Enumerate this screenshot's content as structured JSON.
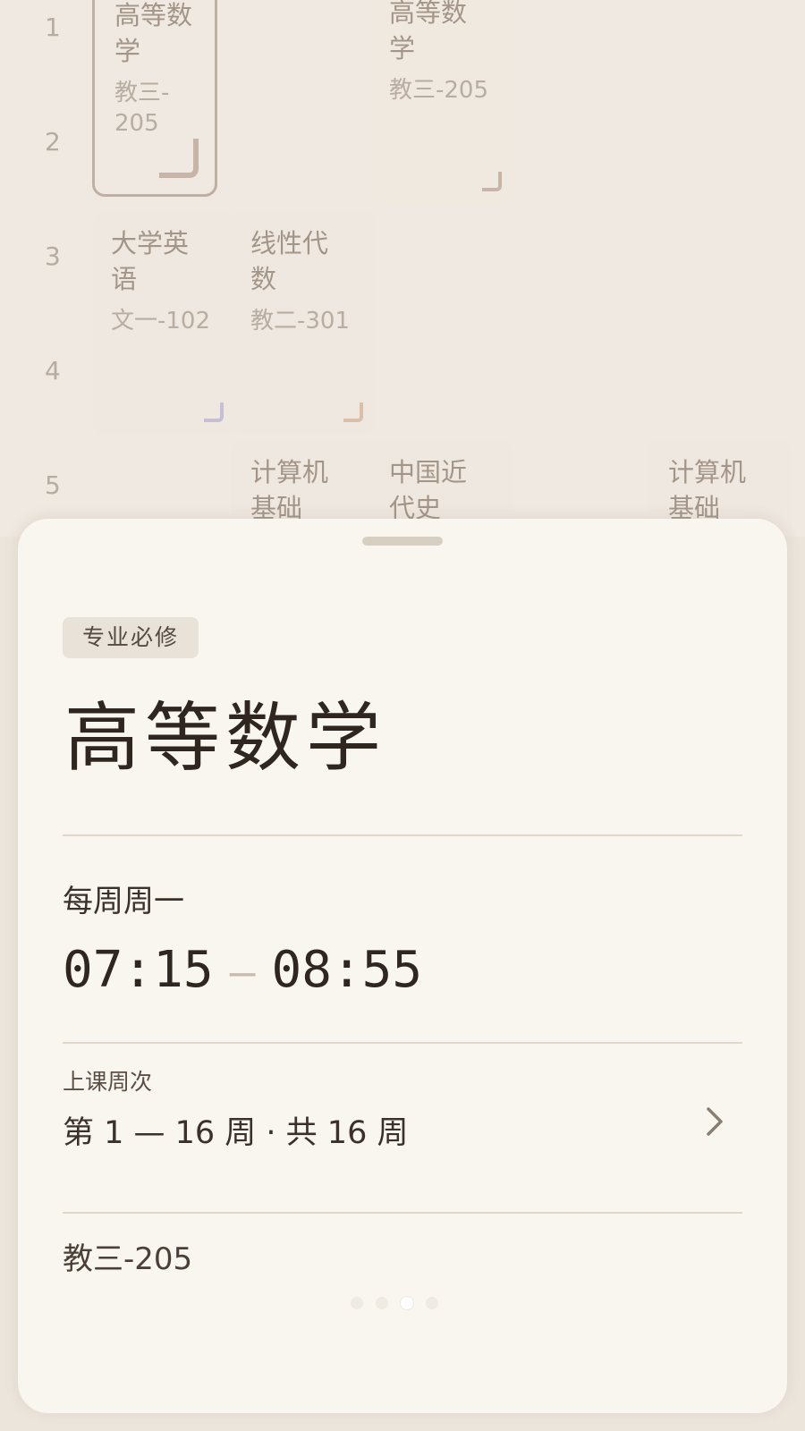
{
  "timetable": {
    "row_numbers": [
      "1",
      "2",
      "3",
      "4",
      "5"
    ],
    "cells": [
      {
        "name": "高等数学",
        "room": "教三-205"
      },
      {
        "name": "高等数学",
        "room": "教三-205"
      },
      {
        "name": "大学英语",
        "room": "文一-102"
      },
      {
        "name": "线性代数",
        "room": "教二-301"
      },
      {
        "name": "计算机基础",
        "room": ""
      },
      {
        "name": "中国近代史",
        "room": ""
      },
      {
        "name": "计算机基础",
        "room": ""
      }
    ]
  },
  "sheet": {
    "tag": "专业必修",
    "title": "高等数学",
    "repeat": "每周周一",
    "time_start": "07:15",
    "time_end": "08:55",
    "weeks_label": "上课周次",
    "weeks_value": "第 1 — 16 周 · 共 16 周",
    "room": "教三-205",
    "pager": {
      "total": 4,
      "active_index": 2
    }
  },
  "colors": {
    "accent_corner_tan": "#c6b5a8",
    "accent_corner_lavender": "#c7bfd3",
    "accent_corner_peach": "#dcbfa9"
  },
  "icons": [
    "chevron-right-icon",
    "corner-mark-icon"
  ]
}
